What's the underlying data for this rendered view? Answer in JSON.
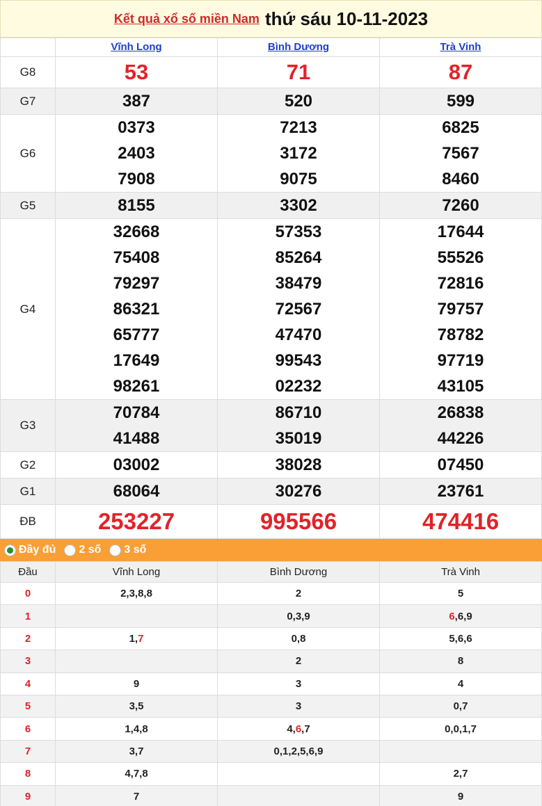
{
  "header": {
    "link_text": "Kết quả xổ số miền Nam",
    "date_text": "thứ sáu 10-11-2023"
  },
  "provinces": [
    "Vĩnh Long",
    "Bình Dương",
    "Trà Vinh"
  ],
  "prizes": [
    {
      "label": "G8",
      "style": "red",
      "alt": false,
      "values": [
        [
          "53"
        ],
        [
          "71"
        ],
        [
          "87"
        ]
      ]
    },
    {
      "label": "G7",
      "style": "normal",
      "alt": true,
      "values": [
        [
          "387"
        ],
        [
          "520"
        ],
        [
          "599"
        ]
      ]
    },
    {
      "label": "G6",
      "style": "normal",
      "alt": false,
      "values": [
        [
          "0373",
          "2403",
          "7908"
        ],
        [
          "7213",
          "3172",
          "9075"
        ],
        [
          "6825",
          "7567",
          "8460"
        ]
      ]
    },
    {
      "label": "G5",
      "style": "normal",
      "alt": true,
      "values": [
        [
          "8155"
        ],
        [
          "3302"
        ],
        [
          "7260"
        ]
      ]
    },
    {
      "label": "G4",
      "style": "normal",
      "alt": false,
      "values": [
        [
          "32668",
          "75408",
          "79297",
          "86321",
          "65777",
          "17649",
          "98261"
        ],
        [
          "57353",
          "85264",
          "38479",
          "72567",
          "47470",
          "99543",
          "02232"
        ],
        [
          "17644",
          "55526",
          "72816",
          "79757",
          "78782",
          "97719",
          "43105"
        ]
      ]
    },
    {
      "label": "G3",
      "style": "normal",
      "alt": true,
      "values": [
        [
          "70784",
          "41488"
        ],
        [
          "86710",
          "35019"
        ],
        [
          "26838",
          "44226"
        ]
      ]
    },
    {
      "label": "G2",
      "style": "normal",
      "alt": false,
      "values": [
        [
          "03002"
        ],
        [
          "38028"
        ],
        [
          "07450"
        ]
      ]
    },
    {
      "label": "G1",
      "style": "normal",
      "alt": true,
      "values": [
        [
          "68064"
        ],
        [
          "30276"
        ],
        [
          "23761"
        ]
      ]
    },
    {
      "label": "ĐB",
      "style": "db",
      "alt": false,
      "values": [
        [
          "253227"
        ],
        [
          "995566"
        ],
        [
          "474416"
        ]
      ]
    }
  ],
  "filter": {
    "options": [
      {
        "label": "Đầy đủ",
        "selected": true
      },
      {
        "label": "2 số",
        "selected": false
      },
      {
        "label": "3 số",
        "selected": false
      }
    ]
  },
  "loto": {
    "head_label": "Đầu",
    "rows": [
      {
        "dau": "0",
        "cells": [
          [
            [
              "2,3,8,8",
              false
            ]
          ],
          [
            [
              "2",
              false
            ]
          ],
          [
            [
              "5",
              false
            ]
          ]
        ]
      },
      {
        "dau": "1",
        "cells": [
          [],
          [
            [
              "0,3,9",
              false
            ]
          ],
          [
            [
              "6",
              true
            ],
            [
              ",6,9",
              false
            ]
          ]
        ]
      },
      {
        "dau": "2",
        "cells": [
          [
            [
              "1,",
              false
            ],
            [
              "7",
              true
            ]
          ],
          [
            [
              "0,8",
              false
            ]
          ],
          [
            [
              "5,6,6",
              false
            ]
          ]
        ]
      },
      {
        "dau": "3",
        "cells": [
          [],
          [
            [
              "2",
              false
            ]
          ],
          [
            [
              "8",
              false
            ]
          ]
        ]
      },
      {
        "dau": "4",
        "cells": [
          [
            [
              "9",
              false
            ]
          ],
          [
            [
              "3",
              false
            ]
          ],
          [
            [
              "4",
              false
            ]
          ]
        ]
      },
      {
        "dau": "5",
        "cells": [
          [
            [
              "3,5",
              false
            ]
          ],
          [
            [
              "3",
              false
            ]
          ],
          [
            [
              "0,7",
              false
            ]
          ]
        ]
      },
      {
        "dau": "6",
        "cells": [
          [
            [
              "1,4,8",
              false
            ]
          ],
          [
            [
              "4,",
              false
            ],
            [
              "6",
              true
            ],
            [
              ",7",
              false
            ]
          ],
          [
            [
              "0,0,1,7",
              false
            ]
          ]
        ]
      },
      {
        "dau": "7",
        "cells": [
          [
            [
              "3,7",
              false
            ]
          ],
          [
            [
              "0,1,2,5,6,9",
              false
            ]
          ],
          []
        ]
      },
      {
        "dau": "8",
        "cells": [
          [
            [
              "4,7,8",
              false
            ]
          ],
          [],
          [
            [
              "2,7",
              false
            ]
          ]
        ]
      },
      {
        "dau": "9",
        "cells": [
          [
            [
              "7",
              false
            ]
          ],
          [],
          [
            [
              "9",
              false
            ]
          ]
        ]
      }
    ]
  },
  "colors": {
    "accent_red": "#e0232a",
    "filter_bar": "#f99f35",
    "province_link": "#1f3fc8"
  }
}
